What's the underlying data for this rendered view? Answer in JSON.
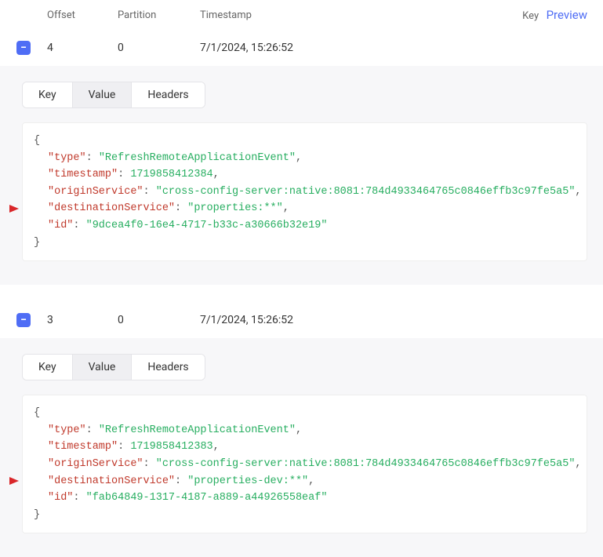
{
  "headers": {
    "offset": "Offset",
    "partition": "Partition",
    "timestamp": "Timestamp",
    "key": "Key",
    "preview": "Preview"
  },
  "tabs": {
    "key": "Key",
    "value": "Value",
    "headers": "Headers"
  },
  "messages": [
    {
      "offset": "4",
      "partition": "0",
      "timestamp": "7/1/2024, 15:26:52",
      "payload": {
        "type": "RefreshRemoteApplicationEvent",
        "timestamp": 1719858412384,
        "originService": "cross-config-server:native:8081:784d4933464765c0846effb3c97fe5a5",
        "destinationService": "properties:**",
        "id": "9dcea4f0-16e4-4717-b33c-a30666b32e19"
      }
    },
    {
      "offset": "3",
      "partition": "0",
      "timestamp": "7/1/2024, 15:26:52",
      "payload": {
        "type": "RefreshRemoteApplicationEvent",
        "timestamp": 1719858412383,
        "originService": "cross-config-server:native:8081:784d4933464765c0846effb3c97fe5a5",
        "destinationService": "properties-dev:**",
        "id": "fab64849-1317-4187-a889-a44926558eaf"
      }
    }
  ]
}
